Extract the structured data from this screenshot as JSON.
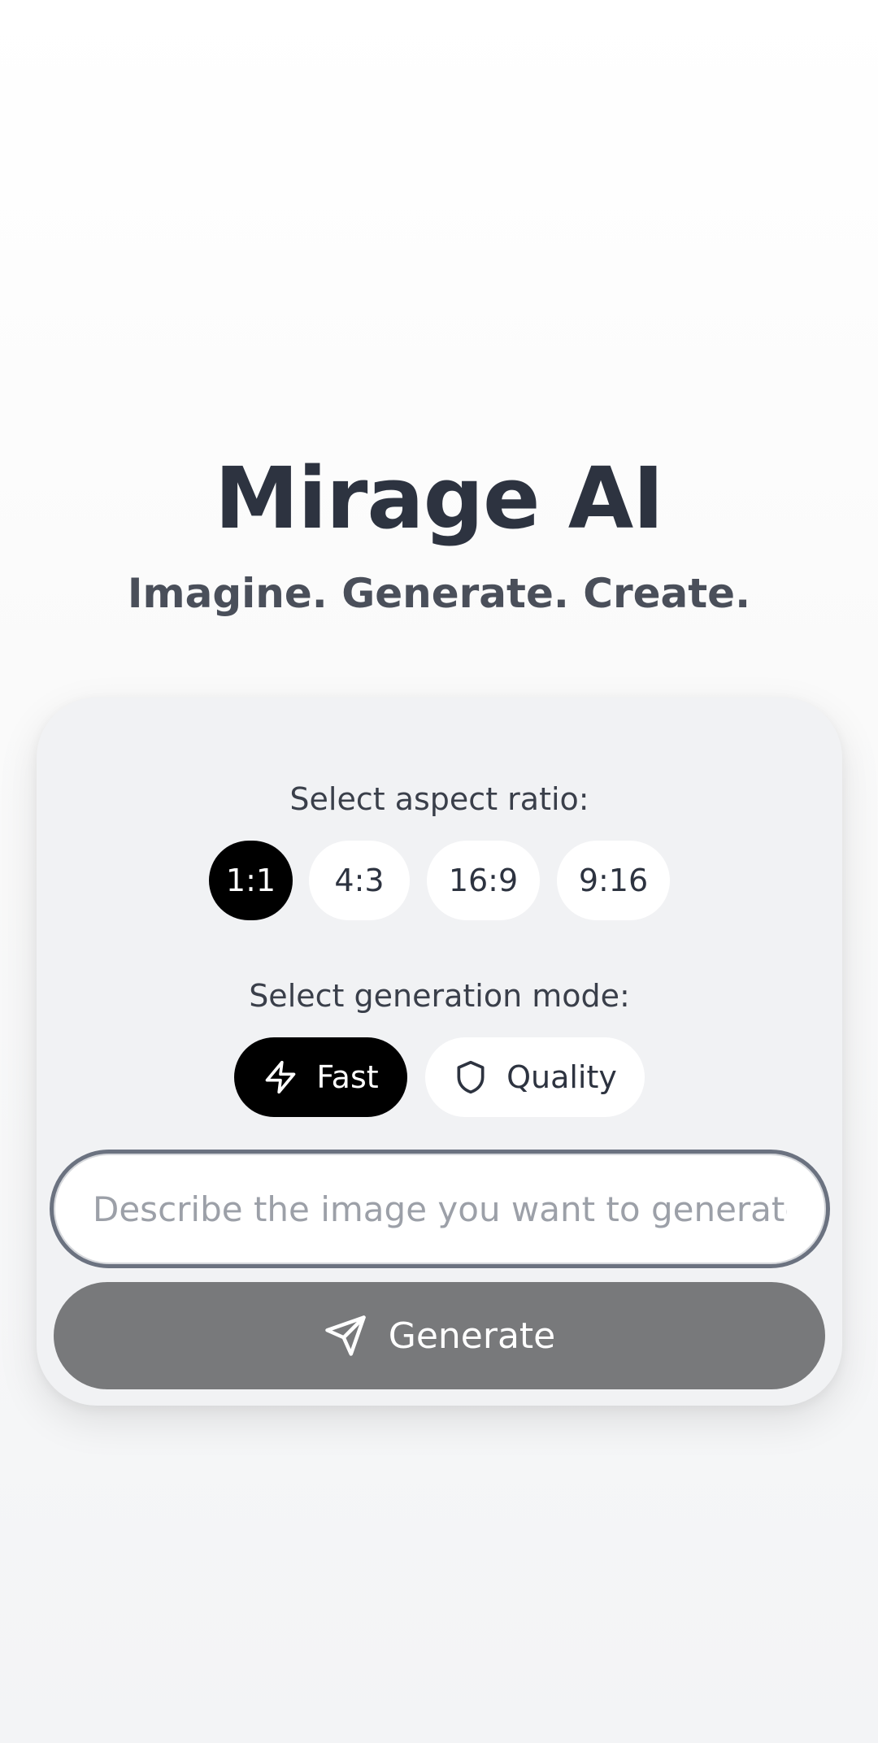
{
  "header": {
    "title": "Mirage AI",
    "tagline": "Imagine. Generate. Create."
  },
  "aspect_ratio": {
    "label": "Select aspect ratio:",
    "options": [
      "1:1",
      "4:3",
      "16:9",
      "9:16"
    ],
    "selected": "1:1"
  },
  "generation_mode": {
    "label": "Select generation mode:",
    "options": [
      {
        "label": "Fast",
        "icon": "lightning-icon"
      },
      {
        "label": "Quality",
        "icon": "shield-icon"
      }
    ],
    "selected": "Fast"
  },
  "prompt": {
    "placeholder": "Describe the image you want to generate",
    "value": ""
  },
  "generate_button": {
    "label": "Generate",
    "icon": "send-icon"
  },
  "colors": {
    "active_pill": "#000000",
    "generate_button_bg": "#78797b",
    "card_bg": "#f1f2f4",
    "title_text": "#2d3340"
  }
}
